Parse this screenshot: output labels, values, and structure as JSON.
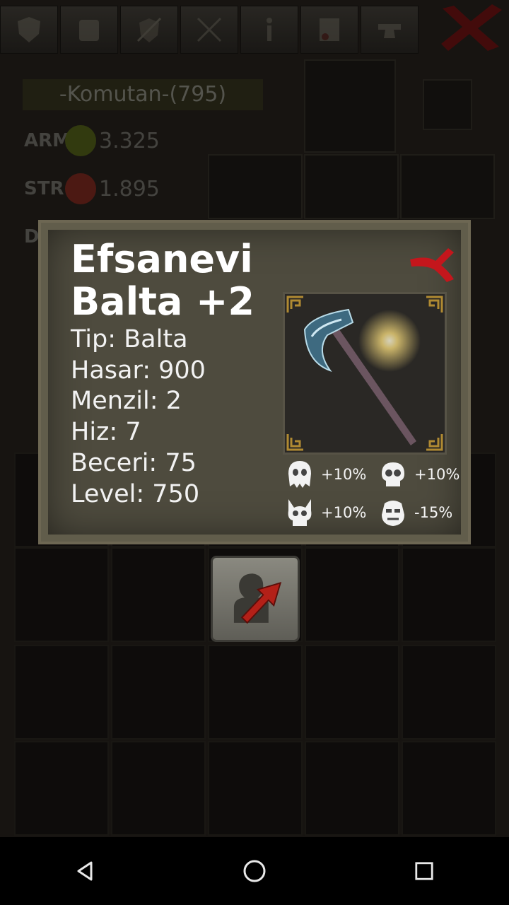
{
  "toolbar": {
    "tools": [
      "shield-tool-icon",
      "armor-tool-icon",
      "sword-shield-tool-icon",
      "crossed-weapons-tool-icon",
      "info-tool-icon",
      "scroll-tool-icon",
      "anvil-tool-icon"
    ],
    "close_icon": "close-icon"
  },
  "character": {
    "rank": "-Komutan-(795)",
    "stats": [
      {
        "label": "ARM",
        "value": "3.325",
        "icon": "armor-icon",
        "color": "#6c7a1f"
      },
      {
        "label": "STR",
        "value": "1.895",
        "icon": "strength-icon",
        "color": "#a33a2c"
      },
      {
        "label": "D",
        "value": "",
        "icon": "",
        "color": ""
      }
    ]
  },
  "popup": {
    "title": "Efsanevi Balta +2",
    "lines": [
      "Tip: Balta",
      "Hasar: 900",
      "Menzil: 2",
      "Hiz: 7",
      "Beceri: 75",
      "Level: 750"
    ],
    "bonuses": [
      {
        "icon": "ghost-skull-icon",
        "value": "+10%"
      },
      {
        "icon": "skull-icon",
        "value": "+10%"
      },
      {
        "icon": "demon-skull-icon",
        "value": "+10%"
      },
      {
        "icon": "orc-face-icon",
        "value": "-15%"
      }
    ],
    "close_icon": "close-icon",
    "item_icon": "axe-icon"
  },
  "actions": {
    "move_icon": "move-to-character-icon"
  },
  "navbar": {
    "buttons": [
      "back-icon",
      "home-icon",
      "recents-icon"
    ]
  },
  "colors": {
    "popup_bg": "#4e4b3e",
    "close_red": "#c4161c",
    "text": "#ffffff"
  }
}
